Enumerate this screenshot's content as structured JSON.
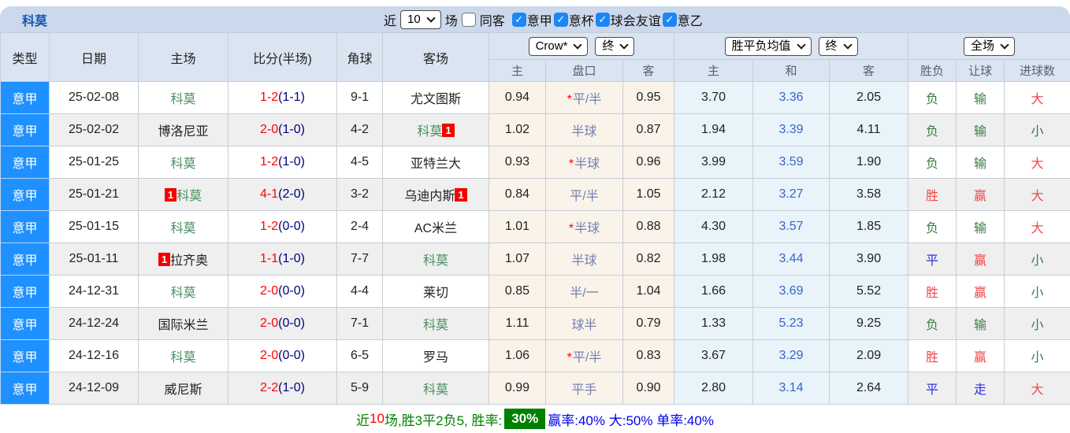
{
  "top_bar": {
    "team_title": "科莫",
    "near_label": "近",
    "matches_count": "10",
    "matches_label": "场",
    "same_opponent": {
      "label": "同客",
      "checked": false
    },
    "leagues": [
      {
        "label": "意甲",
        "checked": true
      },
      {
        "label": "意杯",
        "checked": true
      },
      {
        "label": "球会友谊",
        "checked": true
      },
      {
        "label": "意乙",
        "checked": true
      }
    ]
  },
  "table": {
    "headers": {
      "type": "类型",
      "date": "日期",
      "home": "主场",
      "score": "比分(半场)",
      "corner": "角球",
      "away": "客场",
      "odds_select": "Crow*",
      "odds_time_select": "终",
      "odds_sub": [
        "主",
        "盘口",
        "客"
      ],
      "avg_select": "胜平负均值",
      "avg_time_select": "终",
      "avg_sub": [
        "主",
        "和",
        "客"
      ],
      "result_select": "全场",
      "result_sub": [
        "胜负",
        "让球",
        "进球数"
      ]
    },
    "rows": [
      {
        "league": "意甲",
        "date": "25-02-08",
        "home": "科莫",
        "home_target": true,
        "home_badge": "",
        "away": "尤文图斯",
        "away_target": false,
        "away_badge": "",
        "score": "1-2",
        "half": "(1-1)",
        "corners": "9-1",
        "odds_home": "0.94",
        "handicap_star": true,
        "handicap": "平/半",
        "odds_away": "0.95",
        "avg_home": "3.70",
        "avg_draw": "3.36",
        "avg_away": "2.05",
        "result": "负",
        "handicap_result": "输",
        "goals_result": "大"
      },
      {
        "league": "意甲",
        "date": "25-02-02",
        "home": "博洛尼亚",
        "home_target": false,
        "home_badge": "",
        "away": "科莫",
        "away_target": true,
        "away_badge": "1",
        "score": "2-0",
        "half": "(1-0)",
        "corners": "4-2",
        "odds_home": "1.02",
        "handicap_star": false,
        "handicap": "半球",
        "odds_away": "0.87",
        "avg_home": "1.94",
        "avg_draw": "3.39",
        "avg_away": "4.11",
        "result": "负",
        "handicap_result": "输",
        "goals_result": "小"
      },
      {
        "league": "意甲",
        "date": "25-01-25",
        "home": "科莫",
        "home_target": true,
        "home_badge": "",
        "away": "亚特兰大",
        "away_target": false,
        "away_badge": "",
        "score": "1-2",
        "half": "(1-0)",
        "corners": "4-5",
        "odds_home": "0.93",
        "handicap_star": true,
        "handicap": "半球",
        "odds_away": "0.96",
        "avg_home": "3.99",
        "avg_draw": "3.59",
        "avg_away": "1.90",
        "result": "负",
        "handicap_result": "输",
        "goals_result": "大"
      },
      {
        "league": "意甲",
        "date": "25-01-21",
        "home": "科莫",
        "home_target": true,
        "home_badge": "1",
        "away": "乌迪内斯",
        "away_target": false,
        "away_badge": "1",
        "score": "4-1",
        "half": "(2-0)",
        "corners": "3-2",
        "odds_home": "0.84",
        "handicap_star": false,
        "handicap": "平/半",
        "odds_away": "1.05",
        "avg_home": "2.12",
        "avg_draw": "3.27",
        "avg_away": "3.58",
        "result": "胜",
        "handicap_result": "赢",
        "goals_result": "大"
      },
      {
        "league": "意甲",
        "date": "25-01-15",
        "home": "科莫",
        "home_target": true,
        "home_badge": "",
        "away": "AC米兰",
        "away_target": false,
        "away_badge": "",
        "score": "1-2",
        "half": "(0-0)",
        "corners": "2-4",
        "odds_home": "1.01",
        "handicap_star": true,
        "handicap": "半球",
        "odds_away": "0.88",
        "avg_home": "4.30",
        "avg_draw": "3.57",
        "avg_away": "1.85",
        "result": "负",
        "handicap_result": "输",
        "goals_result": "大"
      },
      {
        "league": "意甲",
        "date": "25-01-11",
        "home": "拉齐奥",
        "home_target": false,
        "home_badge": "1",
        "away": "科莫",
        "away_target": true,
        "away_badge": "",
        "score": "1-1",
        "half": "(1-0)",
        "corners": "7-7",
        "odds_home": "1.07",
        "handicap_star": false,
        "handicap": "半球",
        "odds_away": "0.82",
        "avg_home": "1.98",
        "avg_draw": "3.44",
        "avg_away": "3.90",
        "result": "平",
        "handicap_result": "赢",
        "goals_result": "小"
      },
      {
        "league": "意甲",
        "date": "24-12-31",
        "home": "科莫",
        "home_target": true,
        "home_badge": "",
        "away": "莱切",
        "away_target": false,
        "away_badge": "",
        "score": "2-0",
        "half": "(0-0)",
        "corners": "4-4",
        "odds_home": "0.85",
        "handicap_star": false,
        "handicap": "半/一",
        "odds_away": "1.04",
        "avg_home": "1.66",
        "avg_draw": "3.69",
        "avg_away": "5.52",
        "result": "胜",
        "handicap_result": "赢",
        "goals_result": "小"
      },
      {
        "league": "意甲",
        "date": "24-12-24",
        "home": "国际米兰",
        "home_target": false,
        "home_badge": "",
        "away": "科莫",
        "away_target": true,
        "away_badge": "",
        "score": "2-0",
        "half": "(0-0)",
        "corners": "7-1",
        "odds_home": "1.11",
        "handicap_star": false,
        "handicap": "球半",
        "odds_away": "0.79",
        "avg_home": "1.33",
        "avg_draw": "5.23",
        "avg_away": "9.25",
        "result": "负",
        "handicap_result": "输",
        "goals_result": "小"
      },
      {
        "league": "意甲",
        "date": "24-12-16",
        "home": "科莫",
        "home_target": true,
        "home_badge": "",
        "away": "罗马",
        "away_target": false,
        "away_badge": "",
        "score": "2-0",
        "half": "(0-0)",
        "corners": "6-5",
        "odds_home": "1.06",
        "handicap_star": true,
        "handicap": "平/半",
        "odds_away": "0.83",
        "avg_home": "3.67",
        "avg_draw": "3.29",
        "avg_away": "2.09",
        "result": "胜",
        "handicap_result": "赢",
        "goals_result": "小"
      },
      {
        "league": "意甲",
        "date": "24-12-09",
        "home": "威尼斯",
        "home_target": false,
        "home_badge": "",
        "away": "科莫",
        "away_target": true,
        "away_badge": "",
        "score": "2-2",
        "half": "(1-0)",
        "corners": "5-9",
        "odds_home": "0.99",
        "handicap_star": false,
        "handicap": "平手",
        "odds_away": "0.90",
        "avg_home": "2.80",
        "avg_draw": "3.14",
        "avg_away": "2.64",
        "result": "平",
        "handicap_result": "走",
        "goals_result": "大"
      }
    ]
  },
  "footer": {
    "segments": [
      {
        "text": "近",
        "style": "green"
      },
      {
        "text": "10",
        "style": "red"
      },
      {
        "text": "场,胜3平2负5, 胜率:",
        "style": "green"
      },
      {
        "text": "30%",
        "style": "badge"
      },
      {
        "text": "赢率:40% 大:50% 单率:40%",
        "style": "blue"
      }
    ]
  },
  "colors": {
    "accent_blue": "#1e90ff",
    "topbar_bg": "#ccd8ec",
    "header_bg": "#dbe5f1",
    "target_team_green": "#4a9062",
    "score_red": "#ff0000",
    "half_navy": "#000080",
    "handicap_blue_gray": "#7580b0",
    "draw_avg_blue": "#3366cc",
    "result_red": "#f04848",
    "result_green": "#3a7d44",
    "result_blue": "#2f2fe0",
    "footer_badge_green": "#008000",
    "odds_col_bg": "#faf3ea",
    "avg_col_bg": "#e9f4fa"
  }
}
